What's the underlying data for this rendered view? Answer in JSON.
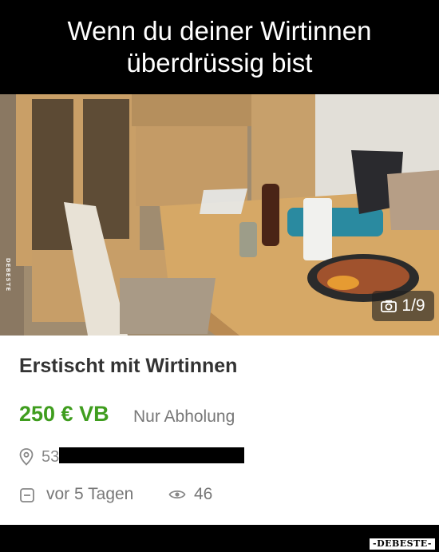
{
  "caption": {
    "line1": "Wenn du deiner Wirtinnen",
    "line2": "überdrüssig bist"
  },
  "photo": {
    "counter": "1/9",
    "camera_icon": "camera-icon",
    "side_watermark": "DEBESTE"
  },
  "listing": {
    "title": "Erstischt mit Wirtinnen",
    "price": "250 € VB",
    "shipping": "Nur Abholung",
    "location_prefix": "53",
    "location_icon": "location-pin-icon",
    "date": "vor 5 Tagen",
    "date_icon": "calendar-icon",
    "views": "46",
    "views_icon": "eye-icon",
    "price_color": "#3f9d1e"
  },
  "watermark": {
    "text": "-DEBESTE-"
  }
}
